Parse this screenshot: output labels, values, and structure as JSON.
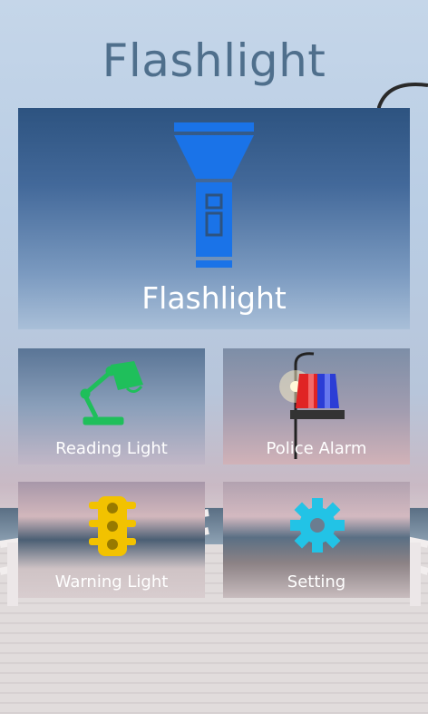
{
  "app": {
    "title": "Flashlight"
  },
  "tiles": {
    "flashlight": {
      "label": "Flashlight",
      "icon": "flashlight-icon",
      "color": "#1a73e8"
    },
    "reading_light": {
      "label": "Reading Light",
      "icon": "desk-lamp-icon",
      "color": "#1fbf5b"
    },
    "police_alarm": {
      "label": "Police Alarm",
      "icon": "siren-icon",
      "colors": [
        "#e02424",
        "#2b3dd6"
      ]
    },
    "warning_light": {
      "label": "Warning Light",
      "icon": "traffic-light-icon",
      "color": "#f2c200"
    },
    "setting": {
      "label": "Setting",
      "icon": "gear-icon",
      "color": "#22c3e6"
    }
  },
  "colors": {
    "title": "#4f6f8c",
    "tile_text": "#ffffff"
  }
}
